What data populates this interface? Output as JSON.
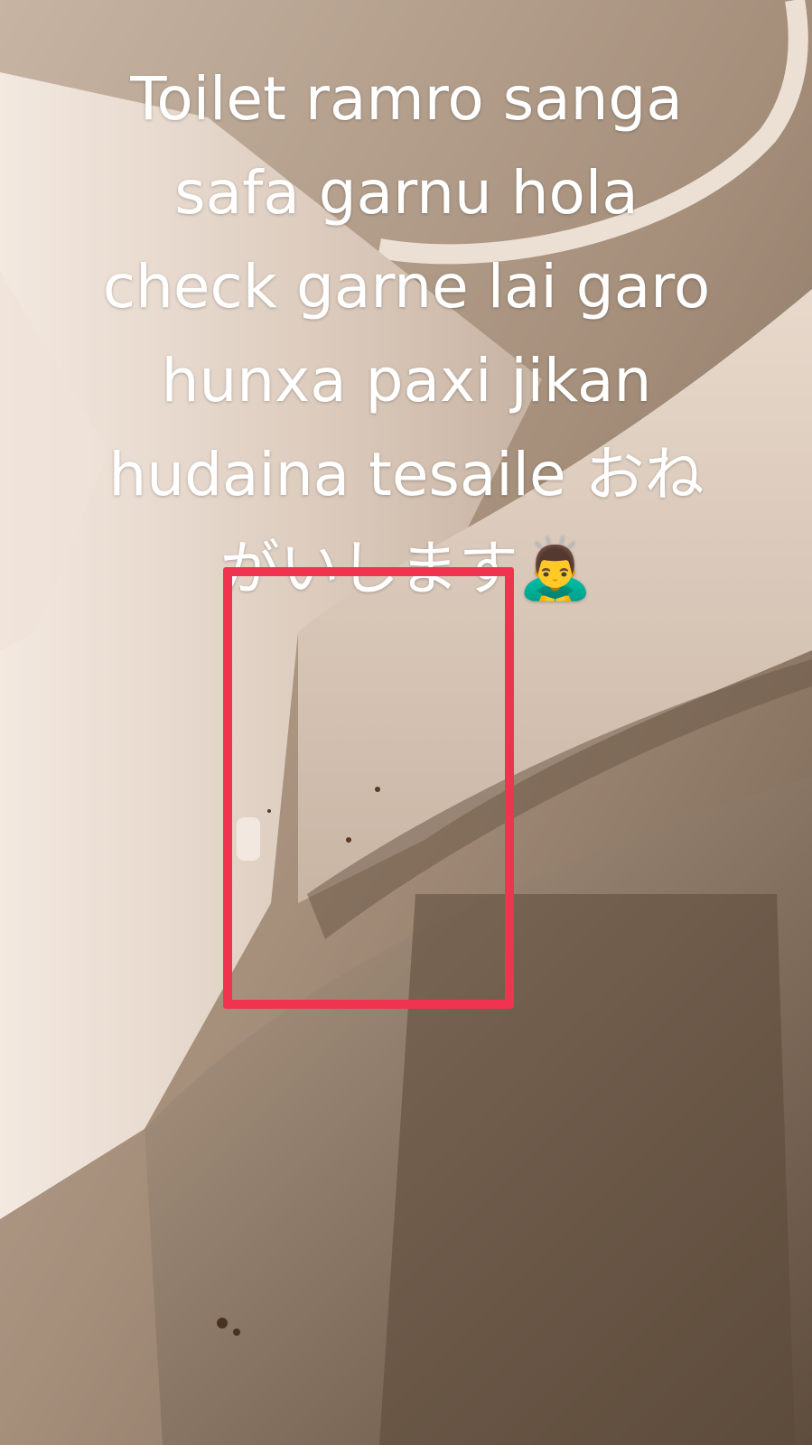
{
  "caption": {
    "lines": [
      "Toilet ramro sanga",
      "safa garnu hola",
      "check garne lai garo",
      "hunxa paxi jikan",
      "hudaina tesaile おね",
      "がいします🙇‍♂️"
    ]
  },
  "annotation": {
    "box_color": "#f0344f",
    "icon": "bowing-man-emoji"
  },
  "colors": {
    "text": "#ffffff",
    "porcelain": "#e9dbd0",
    "shadow": "#6e5a48"
  }
}
